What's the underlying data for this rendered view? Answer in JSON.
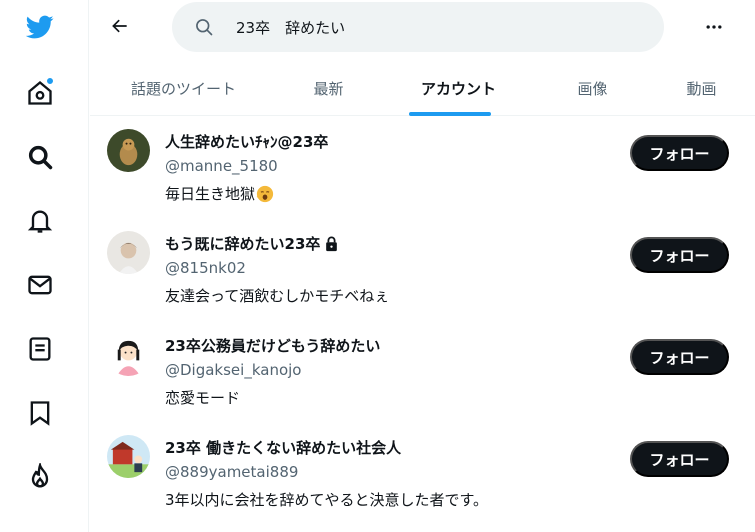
{
  "search": {
    "value": "23卒　辞めたい"
  },
  "tabs": [
    {
      "label": "話題のツイート",
      "active": false
    },
    {
      "label": "最新",
      "active": false
    },
    {
      "label": "アカウント",
      "active": true
    },
    {
      "label": "画像",
      "active": false
    },
    {
      "label": "動画",
      "active": false
    }
  ],
  "nav_icons": [
    "twitter-logo-icon",
    "home-icon",
    "explore-icon",
    "notifications-icon",
    "messages-icon",
    "lists-icon",
    "bookmarks-icon",
    "topics-icon"
  ],
  "colors": {
    "accent": "#1d9bf0",
    "text": "#0f1419",
    "secondary": "#536471",
    "button": "#0f1419"
  },
  "users": [
    {
      "name": "人生辞めたいﾁｬﾝ@23卒",
      "handle": "@manne_5180",
      "bio": "毎日生き地獄",
      "bio_emoji": "yawning-face-emoji",
      "locked": false,
      "follow_label": "フォロー"
    },
    {
      "name": "もう既に辞めたい23卒",
      "handle": "@815nk02",
      "bio": "友達会って酒飲むしかモチベねぇ",
      "locked": true,
      "follow_label": "フォロー"
    },
    {
      "name": "23卒公務員だけどもう辞めたい",
      "handle": "@Digaksei_kanojo",
      "bio": "恋愛モード",
      "locked": false,
      "follow_label": "フォロー"
    },
    {
      "name": "23卒 働きたくない辞めたい社会人",
      "handle": "@889yametai889",
      "bio": "3年以内に会社を辞めてやると決意した者です。",
      "locked": false,
      "follow_label": "フォロー"
    }
  ]
}
